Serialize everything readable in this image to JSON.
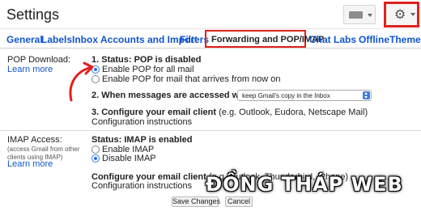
{
  "header": {
    "title": "Settings"
  },
  "icons": {
    "keyboard": "keyboard-icon",
    "settings": "gear-icon"
  },
  "colors": {
    "link": "#1155cc",
    "highlight": "#e0211d",
    "radio_accent": "#1a73e8"
  },
  "tabs": [
    {
      "label": "General"
    },
    {
      "label": "Labels"
    },
    {
      "label": "Inbox"
    },
    {
      "label": "Accounts and Import"
    },
    {
      "label": "Filters"
    },
    {
      "label": "Forwarding and POP/IMAP",
      "active": true
    },
    {
      "label": "Chat"
    },
    {
      "label": "Labs"
    },
    {
      "label": "Offline"
    },
    {
      "label": "Themes"
    }
  ],
  "pop": {
    "label": "POP Download:",
    "learn_more": "Learn more",
    "status_heading": "1. Status: POP is disabled",
    "option_all": "Enable POP for all mail",
    "option_now": "Enable POP for mail that arrives from now on",
    "access_heading": "2. When messages are accessed with POP",
    "access_select": "keep Gmail's copy in the Inbox",
    "client_heading_bold": "3. Configure your email client",
    "client_heading_rest": " (e.g. Outlook, Eudora, Netscape Mail)",
    "config_link": "Configuration instructions"
  },
  "imap": {
    "label": "IMAP Access:",
    "note": "(access Gmail from other clients using IMAP)",
    "learn_more": "Learn more",
    "status_heading": "Status: IMAP is enabled",
    "option_enable": "Enable IMAP",
    "option_disable": "Disable IMAP",
    "client_heading_bold": "Configure your email client",
    "client_heading_rest": " (e.g. Outlook, Thunderbird, iPhone)",
    "config_link": "Configuration instructions"
  },
  "buttons": {
    "save": "Save Changes",
    "cancel": "Cancel"
  },
  "watermark": "ĐỒNG THÁP WEB"
}
